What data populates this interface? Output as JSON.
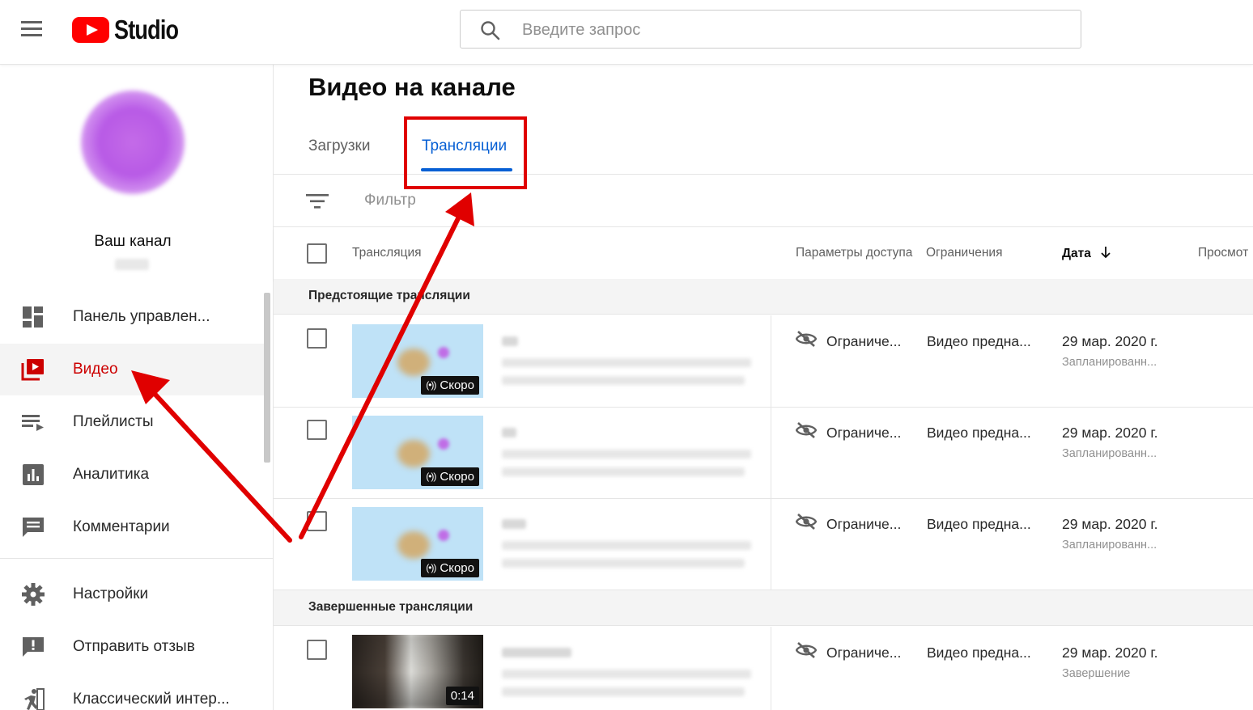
{
  "header": {
    "logo_text": "Studio",
    "search_placeholder": "Введите запрос"
  },
  "sidebar": {
    "channel_name": "Ваш канал",
    "items": [
      {
        "label": "Панель управлен...",
        "icon": "dashboard-icon"
      },
      {
        "label": "Видео",
        "icon": "video-icon",
        "active": true
      },
      {
        "label": "Плейлисты",
        "icon": "playlist-icon"
      },
      {
        "label": "Аналитика",
        "icon": "analytics-icon"
      },
      {
        "label": "Комментарии",
        "icon": "comments-icon"
      },
      {
        "label": "Настройки",
        "icon": "gear-icon"
      },
      {
        "label": "Отправить отзыв",
        "icon": "feedback-icon"
      },
      {
        "label": "Классический интер...",
        "icon": "classic-exit-icon"
      }
    ]
  },
  "main": {
    "title": "Видео на канале",
    "tabs": [
      {
        "label": "Загрузки",
        "active": false
      },
      {
        "label": "Трансляции",
        "active": true
      }
    ],
    "filter_label": "Фильтр",
    "columns": {
      "stream": "Трансляция",
      "access": "Параметры доступа",
      "restrictions": "Ограничения",
      "date": "Дата",
      "views": "Просмот"
    },
    "sections": {
      "upcoming": "Предстоящие трансляции",
      "completed": "Завершенные трансляции"
    },
    "rows": [
      {
        "badge": "Скоро",
        "access": "Ограниче...",
        "restriction": "Видео предна...",
        "date": "29 мар. 2020 г.",
        "status": "Запланированн..."
      },
      {
        "badge": "Скоро",
        "access": "Ограниче...",
        "restriction": "Видео предна...",
        "date": "29 мар. 2020 г.",
        "status": "Запланированн..."
      },
      {
        "badge": "Скоро",
        "access": "Ограниче...",
        "restriction": "Видео предна...",
        "date": "29 мар. 2020 г.",
        "status": "Запланированн..."
      },
      {
        "badge": "0:14",
        "access": "Ограниче...",
        "restriction": "Видео предна...",
        "date": "29 мар. 2020 г.",
        "status": "Завершение"
      }
    ]
  },
  "colors": {
    "brand_red": "#ff0000",
    "active_red": "#cc0000",
    "tab_blue": "#065fd4",
    "annotation_red": "#e00000"
  }
}
